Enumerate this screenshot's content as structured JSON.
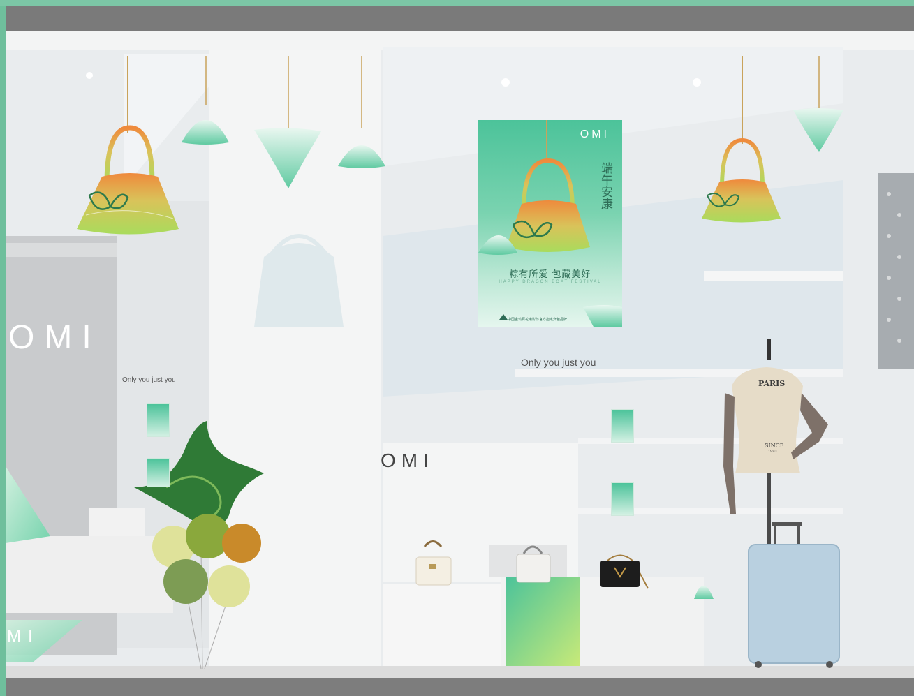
{
  "scene": {
    "brand": "OMI",
    "brand_left": "OMI",
    "brand_center": "OMI",
    "brand_bottom": "MI",
    "tagline_main": "Only you just you",
    "tagline_side": "Only you just you",
    "mannequin_text_top": "PARIS",
    "mannequin_text_bottom": "SINCE",
    "mannequin_year": "1993"
  },
  "poster": {
    "logo": "OMI",
    "vertical_text": "端午安康",
    "slogan": "粽有所爱 包藏美好",
    "subtitle": "HAPPY DRAGON BOAT FESTIVAL",
    "footer": "中国金鸡百花电影节官方指定女包品牌"
  },
  "colors": {
    "accent_green": "#4cc39a",
    "frame_green": "#7cc6a6",
    "bag_orange": "#ef8a3c",
    "bag_lime": "#b7dc5a",
    "balloon_olive": "#8aa83c",
    "balloon_gold": "#c98a2a",
    "balloon_cream": "#dfe29a",
    "luggage_blue": "#b9d0e0"
  },
  "icons": {
    "handbag": "handbag-icon",
    "zongzi": "zongzi-triangle-icon",
    "balloon": "balloon-icon",
    "mannequin": "mannequin-icon",
    "suitcase": "suitcase-icon"
  }
}
